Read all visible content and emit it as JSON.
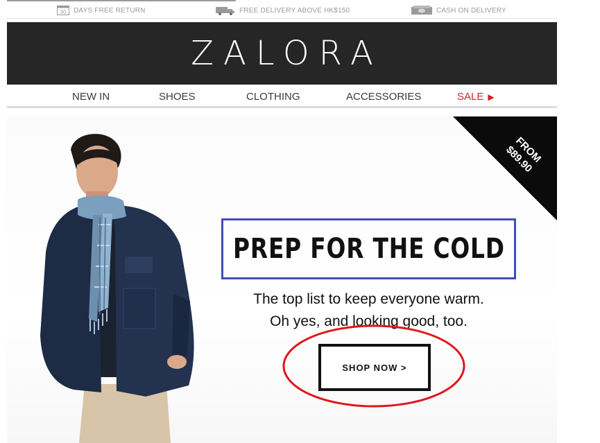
{
  "perks": [
    {
      "icon": "calendar-icon",
      "badge": "30",
      "label": "DAYS FREE RETURN"
    },
    {
      "icon": "delivery-truck-icon",
      "label": "FREE DELIVERY ABOVE HK$150"
    },
    {
      "icon": "cash-icon",
      "label": "CASH ON DELIVERY"
    }
  ],
  "brand": {
    "logo": "ZALORA"
  },
  "nav": {
    "items": [
      "NEW IN",
      "SHOES",
      "CLOTHING",
      "ACCESSORIES"
    ],
    "sale_label": "SALE"
  },
  "hero": {
    "price_tag": {
      "line1": "FROM",
      "line2": "$89.90"
    },
    "headline": "PREP FOR THE COLD",
    "subcopy_line1": "The top list to keep everyone warm.",
    "subcopy_line2": "Oh yes, and looking good, too.",
    "cta_label": "SHOP NOW >"
  },
  "colors": {
    "sale": "#d6202b",
    "headline_outline": "#3f4fb8",
    "cta_highlight": "#e0161c",
    "brand_bar": "#262626"
  }
}
